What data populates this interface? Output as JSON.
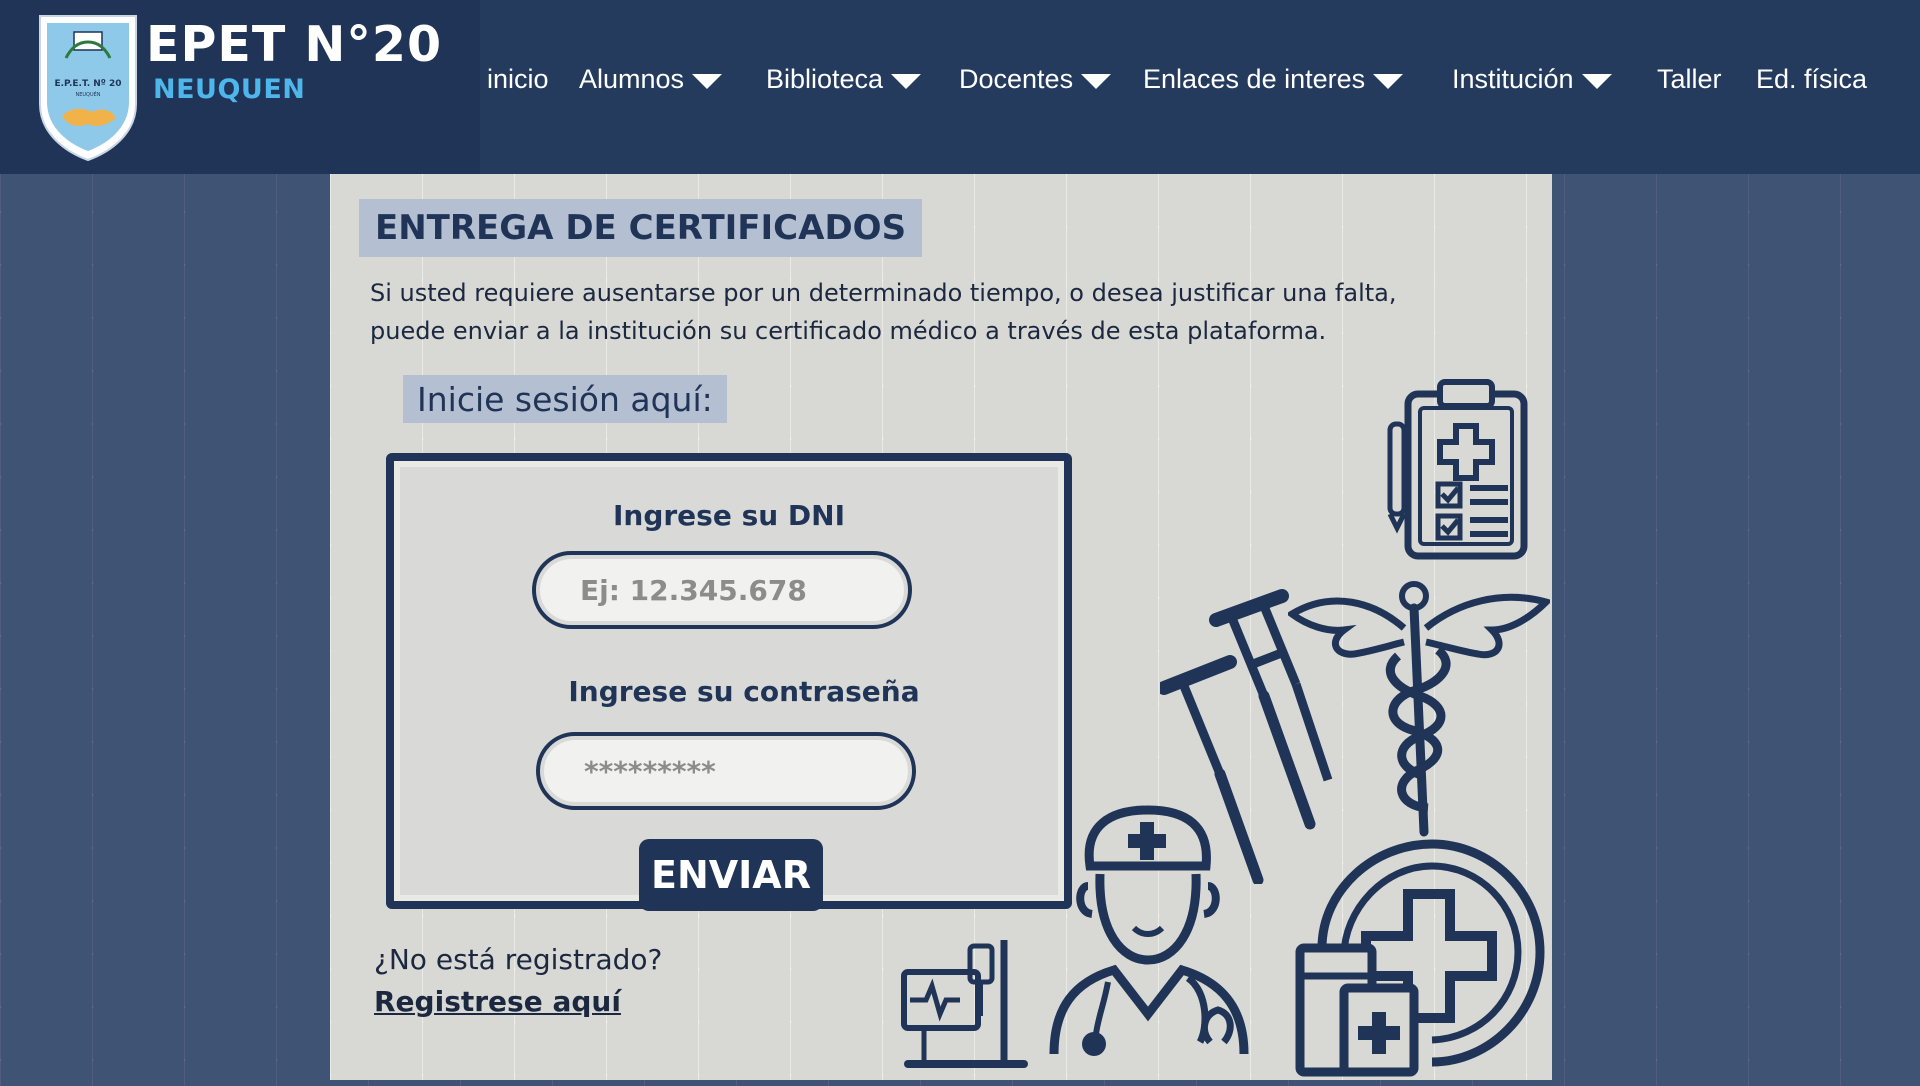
{
  "colors": {
    "navy": "#1f3456",
    "header_bg": "#243b5e",
    "accent_blue": "#4fb6ec",
    "panel_bg": "#d8d8d4",
    "heading_highlight": "#b4bfd1"
  },
  "brand": {
    "title": "EPET N°20",
    "subtitle": "NEUQUEN",
    "shield_text": "E.P.E.T. Nº 20",
    "shield_subtext": "NEUQUÉN"
  },
  "nav": {
    "items": [
      {
        "label": "inicio",
        "has_dropdown": false
      },
      {
        "label": "Alumnos",
        "has_dropdown": true
      },
      {
        "label": "Biblioteca",
        "has_dropdown": true
      },
      {
        "label": "Docentes",
        "has_dropdown": true
      },
      {
        "label": "Enlaces de interes",
        "has_dropdown": true
      },
      {
        "label": "Institución",
        "has_dropdown": true
      },
      {
        "label": "Taller",
        "has_dropdown": false
      },
      {
        "label": "Ed. física",
        "has_dropdown": false
      }
    ]
  },
  "main": {
    "heading": "ENTREGA DE CERTIFICADOS",
    "intro_line1": "Si usted requiere ausentarse por un determinado tiempo, o desea justificar una falta,",
    "intro_line2": "puede enviar a la institución su certificado médico a través de esta plataforma.",
    "login_label": "Inicie sesión aquí:"
  },
  "form": {
    "dni_label": "Ingrese su DNI",
    "dni_placeholder": "Ej: 12.345.678",
    "password_label": "Ingrese su contraseña",
    "password_placeholder": "*********",
    "submit_label": "ENVIAR"
  },
  "register": {
    "prompt": "¿No está registrado?",
    "link_label": "Registrese aquí"
  },
  "illustration_icons": [
    "clipboard-checklist-icon",
    "crutches-icon",
    "caduceus-icon",
    "nurse-icon",
    "medical-monitor-icon",
    "medicine-cross-icon"
  ]
}
